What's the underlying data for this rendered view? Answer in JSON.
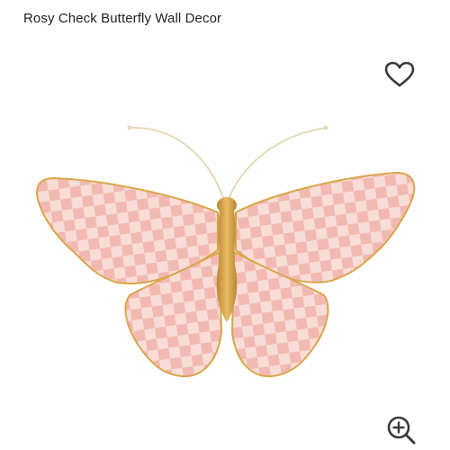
{
  "product": {
    "title": "Rosy Check Butterfly Wall Decor"
  },
  "icons": {
    "wishlist": "heart-outline-icon",
    "zoom": "zoom-in-icon"
  },
  "colors": {
    "text": "#222222",
    "icon": "#3a3a3a",
    "check_pink": "#f2b9b3",
    "check_cream": "#fbf6ea",
    "gold": "#d9a64a"
  }
}
